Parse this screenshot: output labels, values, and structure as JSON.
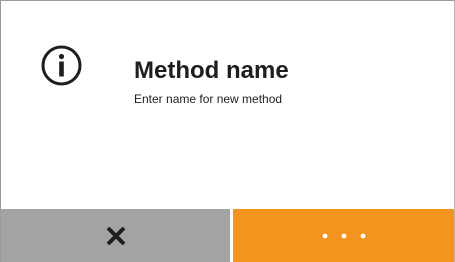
{
  "dialog": {
    "icon": "info-icon",
    "title": "Method name",
    "message": "Enter name for new method"
  },
  "buttons": {
    "cancel_icon": "close-icon",
    "more_icon": "more-dots-icon"
  },
  "colors": {
    "cancel_button": "#a3a3a3",
    "more_button": "#f5931f",
    "text": "#1e1e1e"
  }
}
